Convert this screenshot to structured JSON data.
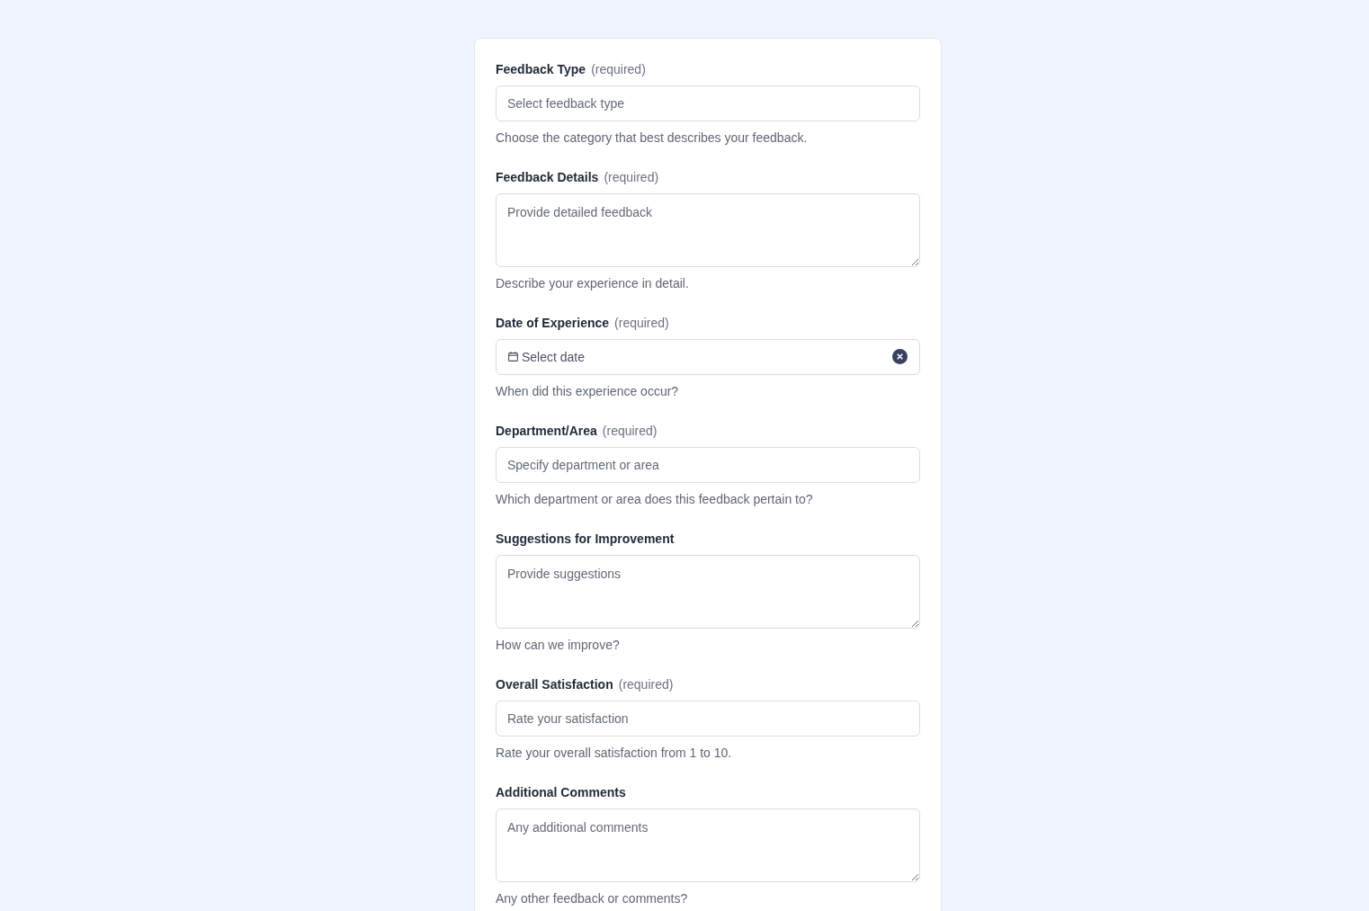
{
  "form": {
    "fields": [
      {
        "kind": "select",
        "label": "Feedback Type",
        "note": "(required)",
        "placeholder": "Select feedback type",
        "help": "Choose the category that best describes your feedback."
      },
      {
        "kind": "textarea",
        "label": "Feedback Details",
        "note": "(required)",
        "placeholder": "Provide detailed feedback",
        "help": "Describe your experience in detail."
      },
      {
        "kind": "date",
        "label": "Date of Experience",
        "note": "(required)",
        "placeholder": "Select date",
        "help": "When did this experience occur?"
      },
      {
        "kind": "text",
        "label": "Department/Area",
        "note": "(required)",
        "placeholder": "Specify department or area",
        "help": "Which department or area does this feedback pertain to?"
      },
      {
        "kind": "textarea",
        "label": "Suggestions for Improvement",
        "placeholder": "Provide suggestions",
        "help": "How can we improve?"
      },
      {
        "kind": "text",
        "label": "Overall Satisfaction",
        "note": "(required)",
        "placeholder": "Rate your satisfaction",
        "help": "Rate your overall satisfaction from 1 to 10."
      },
      {
        "kind": "textarea",
        "label": "Additional Comments",
        "placeholder": "Any additional comments",
        "help": "Any other feedback or comments?"
      }
    ]
  }
}
